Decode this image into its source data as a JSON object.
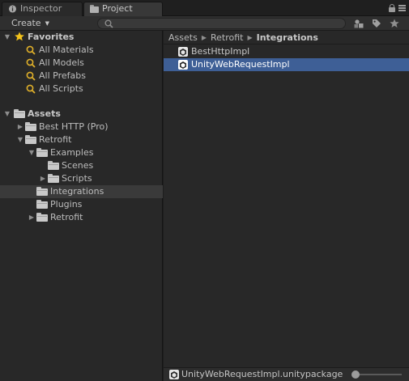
{
  "tabs": [
    {
      "label": "Inspector",
      "icon": "info-icon"
    },
    {
      "label": "Project",
      "icon": "folder-icon"
    }
  ],
  "toolbar": {
    "create_label": "Create",
    "search": {
      "placeholder": ""
    }
  },
  "favorites": {
    "label": "Favorites",
    "items": [
      "All Materials",
      "All Models",
      "All Prefabs",
      "All Scripts"
    ]
  },
  "assets": {
    "label": "Assets",
    "tree": [
      {
        "label": "Best HTTP (Pro)"
      },
      {
        "label": "Retrofit"
      },
      {
        "label": "Examples"
      },
      {
        "label": "Scenes"
      },
      {
        "label": "Scripts"
      },
      {
        "label": "Integrations"
      },
      {
        "label": "Plugins"
      },
      {
        "label": "Retrofit"
      }
    ]
  },
  "breadcrumb": [
    "Assets",
    "Retrofit",
    "Integrations"
  ],
  "files": [
    {
      "label": "BestHttpImpl"
    },
    {
      "label": "UnityWebRequestImpl"
    }
  ],
  "status": {
    "label": "UnityWebRequestImpl.unitypackage"
  },
  "colors": {
    "selection": "#3e5f96",
    "favorite_star": "#f2c21b",
    "search_glyph": "#e0b02a"
  }
}
